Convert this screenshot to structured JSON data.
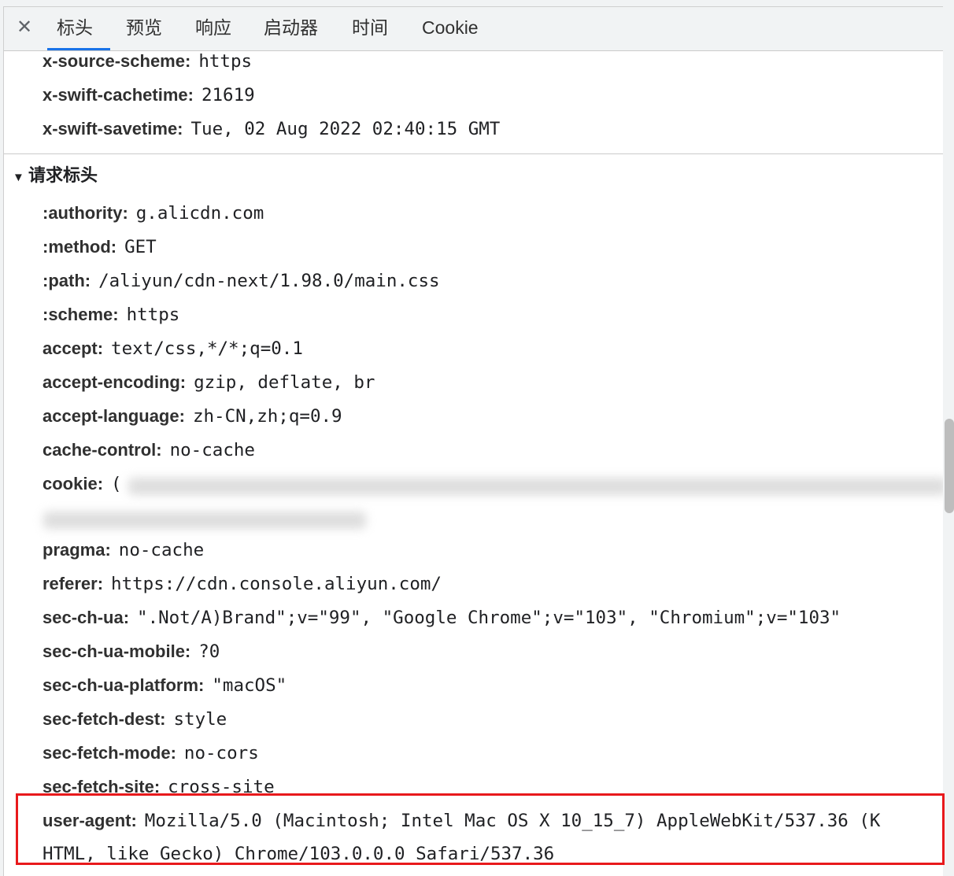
{
  "tabs": {
    "close_icon": "✕",
    "items": [
      {
        "label": "标头",
        "active": true
      },
      {
        "label": "预览",
        "active": false
      },
      {
        "label": "响应",
        "active": false
      },
      {
        "label": "启动器",
        "active": false
      },
      {
        "label": "时间",
        "active": false
      },
      {
        "label": "Cookie",
        "active": false
      }
    ]
  },
  "response_headers": [
    {
      "key": "x-source-scheme:",
      "value": "https"
    },
    {
      "key": "x-swift-cachetime:",
      "value": "21619"
    },
    {
      "key": "x-swift-savetime:",
      "value": "Tue, 02 Aug 2022 02:40:15 GMT"
    }
  ],
  "request_section": {
    "toggle_icon": "▼",
    "title": "请求标头"
  },
  "request_headers": [
    {
      "key": ":authority:",
      "value": "g.alicdn.com"
    },
    {
      "key": ":method:",
      "value": "GET"
    },
    {
      "key": ":path:",
      "value": "/aliyun/cdn-next/1.98.0/main.css"
    },
    {
      "key": ":scheme:",
      "value": "https"
    },
    {
      "key": "accept:",
      "value": "text/css,*/*;q=0.1"
    },
    {
      "key": "accept-encoding:",
      "value": "gzip, deflate, br"
    },
    {
      "key": "accept-language:",
      "value": "zh-CN,zh;q=0.9"
    },
    {
      "key": "cache-control:",
      "value": "no-cache"
    },
    {
      "key": "cookie:",
      "value": "("
    },
    {
      "key": "pragma:",
      "value": "no-cache"
    },
    {
      "key": "referer:",
      "value": "https://cdn.console.aliyun.com/"
    },
    {
      "key": "sec-ch-ua:",
      "value": "\".Not/A)Brand\";v=\"99\", \"Google Chrome\";v=\"103\", \"Chromium\";v=\"103\""
    },
    {
      "key": "sec-ch-ua-mobile:",
      "value": "?0"
    },
    {
      "key": "sec-ch-ua-platform:",
      "value": "\"macOS\""
    },
    {
      "key": "sec-fetch-dest:",
      "value": "style"
    },
    {
      "key": "sec-fetch-mode:",
      "value": "no-cors"
    },
    {
      "key": "sec-fetch-site:",
      "value": "cross-site"
    },
    {
      "key": "user-agent:",
      "value": "Mozilla/5.0 (Macintosh; Intel Mac OS X 10_15_7) AppleWebKit/537.36 (K"
    }
  ],
  "user_agent_continuation": "HTML, like Gecko) Chrome/103.0.0.0 Safari/537.36",
  "colors": {
    "highlight_border": "#e8191c",
    "active_tab_underline": "#1a73e8"
  }
}
